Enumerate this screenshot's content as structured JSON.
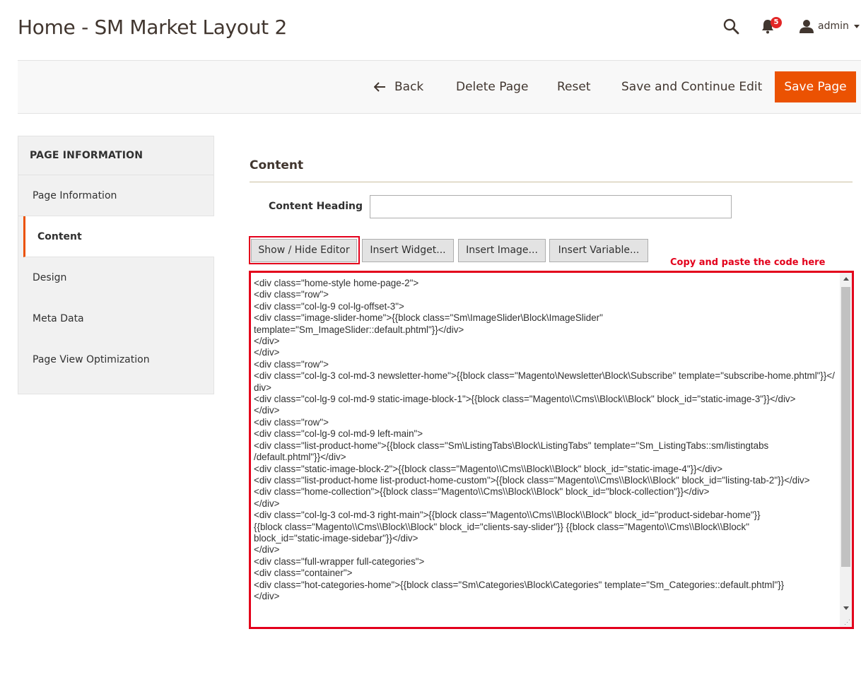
{
  "header": {
    "page_title": "Home - SM Market Layout 2",
    "notifications_count": "5",
    "user_name": "admin"
  },
  "actions": {
    "back_label": "Back",
    "delete_label": "Delete Page",
    "reset_label": "Reset",
    "save_continue_label": "Save and Continue Edit",
    "save_label": "Save Page",
    "accent_color": "#eb5202"
  },
  "sidebar": {
    "title": "PAGE INFORMATION",
    "items": [
      {
        "label": "Page Information"
      },
      {
        "label": "Content"
      },
      {
        "label": "Design"
      },
      {
        "label": "Meta Data"
      },
      {
        "label": "Page View Optimization"
      }
    ],
    "active_item": "Content"
  },
  "content": {
    "section_title": "Content",
    "heading_label": "Content Heading",
    "heading_value": "",
    "buttons": {
      "show_hide": "Show / Hide Editor",
      "insert_widget": "Insert Widget...",
      "insert_image": "Insert Image...",
      "insert_variable": "Insert Variable..."
    },
    "annotation": "Copy and paste the code here",
    "annotation_color": "#e3001b",
    "code": "<div class=\"home-style home-page-2\">\n<div class=\"row\">\n<div class=\"col-lg-9 col-lg-offset-3\">\n<div class=\"image-slider-home\">{{block class=\"Sm\\ImageSlider\\Block\\ImageSlider\"\ntemplate=\"Sm_ImageSlider::default.phtml\"}}</div>\n</div>\n</div>\n<div class=\"row\">\n<div class=\"col-lg-3 col-md-3 newsletter-home\">{{block class=\"Magento\\Newsletter\\Block\\Subscribe\" template=\"subscribe-home.phtml\"}}</div>\n<div class=\"col-lg-9 col-md-9 static-image-block-1\">{{block class=\"Magento\\\\Cms\\\\Block\\\\Block\" block_id=\"static-image-3\"}}</div>\n</div>\n<div class=\"row\">\n<div class=\"col-lg-9 col-md-9 left-main\">\n<div class=\"list-product-home\">{{block class=\"Sm\\ListingTabs\\Block\\ListingTabs\" template=\"Sm_ListingTabs::sm/listingtabs\n/default.phtml\"}}</div>\n<div class=\"static-image-block-2\">{{block class=\"Magento\\\\Cms\\\\Block\\\\Block\" block_id=\"static-image-4\"}}</div>\n<div class=\"list-product-home list-product-home-custom\">{{block class=\"Magento\\\\Cms\\\\Block\\\\Block\" block_id=\"listing-tab-2\"}}</div>\n<div class=\"home-collection\">{{block class=\"Magento\\\\Cms\\\\Block\\\\Block\" block_id=\"block-collection\"}}</div>\n</div>\n<div class=\"col-lg-3 col-md-3 right-main\">{{block class=\"Magento\\\\Cms\\\\Block\\\\Block\" block_id=\"product-sidebar-home\"}}\n{{block class=\"Magento\\\\Cms\\\\Block\\\\Block\" block_id=\"clients-say-slider\"}} {{block class=\"Magento\\\\Cms\\\\Block\\\\Block\"\nblock_id=\"static-image-sidebar\"}}</div>\n</div>\n<div class=\"full-wrapper full-categories\">\n<div class=\"container\">\n<div class=\"hot-categories-home\">{{block class=\"Sm\\Categories\\Block\\Categories\" template=\"Sm_Categories::default.phtml\"}}\n</div>"
  }
}
